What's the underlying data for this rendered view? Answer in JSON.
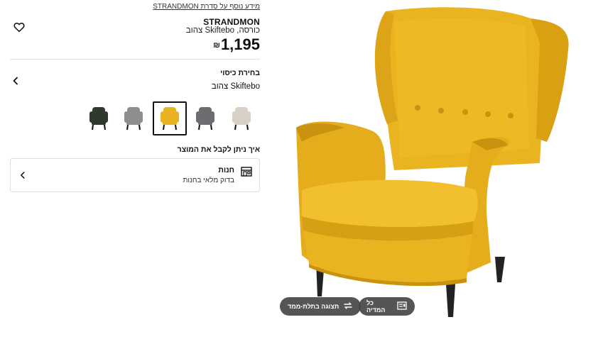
{
  "product": {
    "series_link": "מידע נוסף על סדרת STRANDMON",
    "name": "STRANDMON",
    "description": "כורסה, Skiftebo צהוב",
    "price": "1,195",
    "currency": "₪"
  },
  "cover": {
    "heading": "בחירת כיסוי",
    "selected": "Skiftebo צהוב",
    "swatches": [
      {
        "color": "#2e3a2c",
        "label": "dark-green"
      },
      {
        "color": "#8e8e8e",
        "label": "grey"
      },
      {
        "color": "#e8b320",
        "label": "yellow",
        "selected": true
      },
      {
        "color": "#6b6d72",
        "label": "dark-grey"
      },
      {
        "color": "#d8d0c4",
        "label": "beige"
      }
    ]
  },
  "delivery": {
    "heading": "איך ניתן לקבל את המוצר",
    "store_title": "חנות",
    "store_subtitle": "בדוק מלאי בחנות"
  },
  "media": {
    "view_3d_label": "תצוגה בתלת-ממד",
    "all_media_label": "כל המדיה"
  },
  "colors": {
    "accent": "#111111",
    "border": "#dfdfdf",
    "pill_bg": "#464646",
    "chair_yellow": "#eab320"
  }
}
